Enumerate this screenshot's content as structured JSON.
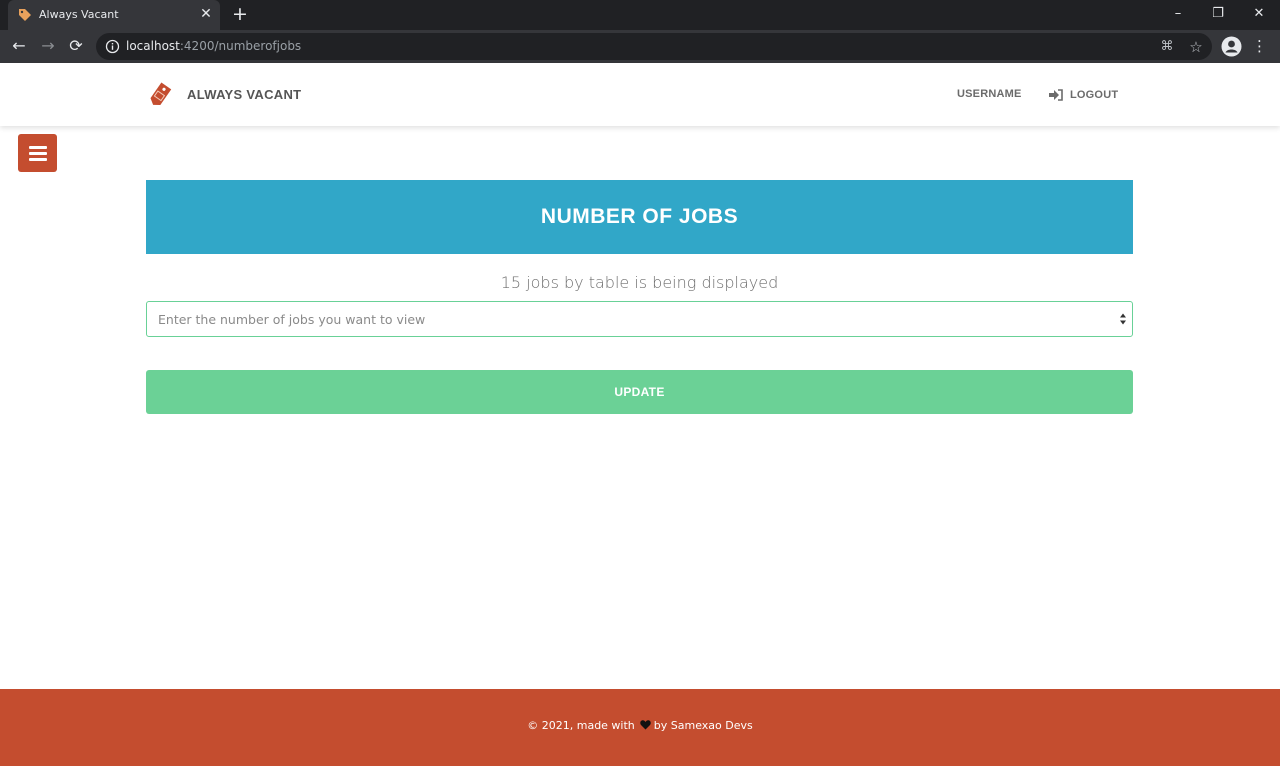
{
  "browser": {
    "tab_title": "Always Vacant",
    "tab_close": "✕",
    "new_tab": "+",
    "url_host": "localhost",
    "url_rest": ":4200/numberofjobs",
    "window_controls": {
      "minimize": "–",
      "restore": "❐",
      "close": "✕"
    },
    "nav": {
      "back": "←",
      "forward": "→",
      "reload": "⟳"
    },
    "omnibox_icons": {
      "translate": "⌘",
      "bookmark": "☆"
    },
    "menu": "⋮"
  },
  "header": {
    "brand": "ALWAYS VACANT",
    "username": "USERNAME",
    "logout": "LOGOUT"
  },
  "main": {
    "title": "NUMBER OF JOBS",
    "status": "15 jobs by table is being displayed",
    "input_placeholder": "Enter the number of jobs you want to view",
    "input_value": "",
    "update_label": "UPDATE"
  },
  "footer": {
    "prefix": "© 2021, made with",
    "suffix": "by Samexao Devs"
  },
  "colors": {
    "accent": "#c44d2f",
    "title_bar": "#31a7c8",
    "success": "#6bd196"
  }
}
